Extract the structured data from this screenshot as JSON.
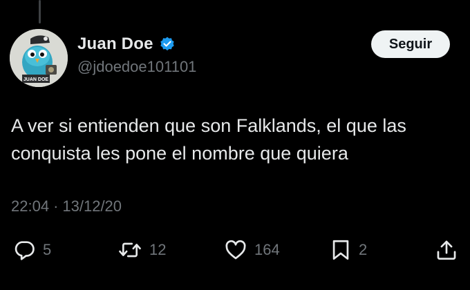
{
  "tweet": {
    "author": {
      "display_name": "Juan Doe",
      "handle": "@jdoedoe101101",
      "verified": true,
      "avatar_label": "JUAN DOE"
    },
    "follow_label": "Seguir",
    "text": "A ver si entienden que son Falklands, el que las conquista les pone el nombre que quiera",
    "time": "22:04",
    "separator": "·",
    "date": "13/12/20",
    "actions": {
      "replies": {
        "icon": "reply-icon",
        "count": "5"
      },
      "retweets": {
        "icon": "retweet-icon",
        "count": "12"
      },
      "likes": {
        "icon": "heart-icon",
        "count": "164"
      },
      "bookmarks": {
        "icon": "bookmark-icon",
        "count": "2"
      },
      "share": {
        "icon": "share-icon"
      }
    }
  },
  "colors": {
    "background": "#000000",
    "primary_text": "#e7e9ea",
    "secondary_text": "#71767b",
    "verified_blue": "#1d9bf0",
    "follow_button_bg": "#eff3f4",
    "follow_button_text": "#0f1419"
  }
}
